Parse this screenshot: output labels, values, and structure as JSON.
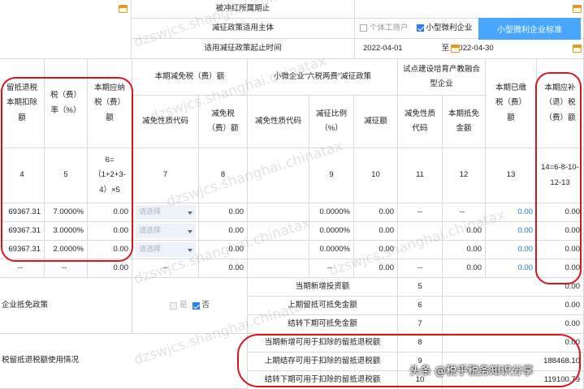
{
  "header": {
    "period_label": "被冲红所属期止",
    "subject_label": "减征政策适用主体",
    "option_individual": "个体工商户",
    "option_small": "小型微利企业",
    "small_standard_btn": "小型微利企业标准",
    "date_range_label": "适用减征政策起止时间",
    "date_start": "2022-04-01",
    "date_to": "至",
    "date_end": "2022-04-30"
  },
  "columns": {
    "col4": "留抵退税本期扣除额",
    "col5": "税（费）率（%）",
    "col6": "本期应纳税（费）额",
    "group_reduce": "本期减免税（费）额",
    "col7": "减免性质代码",
    "col8": "减免税（费）额",
    "group_six": "小微企业“六税两费”减征政策",
    "col9_code": "减免性质代码",
    "col9": "减征比例（%）",
    "col10": "减征额",
    "group_pilot": "试点建设培育产教融合型企业",
    "col11": "减免性质代码",
    "col12": "本期抵免金额",
    "col13": "本期已缴税（费）额",
    "col14": "本期应补（退）税（费）额"
  },
  "col_index": {
    "c4": "4",
    "c5": "5",
    "c6": "6=（1+2+3-4）×5",
    "c7": "7",
    "c8": "8",
    "c9": "9",
    "c10": "10",
    "c11": "11",
    "c12": "12",
    "c13": "13",
    "c14": "14=6-8-10-12-13"
  },
  "rows": [
    {
      "c4": "69367.31",
      "c5": "7.0000%",
      "c6": "0.00",
      "c7": "请选择",
      "c8": "0.00",
      "c9": "0.0000%",
      "c10": "0.00",
      "c11": "--",
      "c12": "--",
      "c13": "0.00",
      "c14": "0.00"
    },
    {
      "c4": "69367.31",
      "c5": "3.0000%",
      "c6": "0.00",
      "c7": "请选择",
      "c8": "0.00",
      "c9": "0.0000%",
      "c10": "0.00",
      "c11": "",
      "c12": "0.00",
      "c13": "0.00",
      "c14": "0.00"
    },
    {
      "c4": "69367.31",
      "c5": "2.0000%",
      "c6": "0.00",
      "c7": "请选择",
      "c8": "0.00",
      "c9": "0.0000%",
      "c10": "0.00",
      "c11": "",
      "c12": "0.00",
      "c13": "0.00",
      "c14": "0.00"
    },
    {
      "c4": "--",
      "c5": "--",
      "c6": "0.00",
      "c7": "--",
      "c8": "0.00",
      "c9": "--",
      "c10": "0.00",
      "c11": "--",
      "c12": "0.00",
      "c13": "0.00",
      "c14": "0.00"
    }
  ],
  "offset": {
    "section_label": "企业抵免政策",
    "yes": "是",
    "no": "否",
    "lines": [
      {
        "label": "当期新增投资额",
        "num": "5",
        "value": "0.00"
      },
      {
        "label": "上期留抵可抵免金额",
        "num": "6",
        "value": "0.00"
      },
      {
        "label": "结转下期可抵免金额",
        "num": "7",
        "value": "0.00"
      }
    ]
  },
  "credit": {
    "section_label": "税留抵退税额使用情况",
    "lines": [
      {
        "label": "当期新增可用于扣除的留抵退税额",
        "num": "8",
        "value": "0.00"
      },
      {
        "label": "上期结存可用于扣除的留抵退税额",
        "num": "9",
        "value": "188468.10"
      },
      {
        "label": "结转下期可用于扣除的留抵退税额",
        "num": "10",
        "value": "119100.79"
      }
    ]
  },
  "watermark": "dzswjcs.shanghai.chinatax",
  "brand": "头条 @税乎税务知识分享",
  "colors": {
    "accent": "#48a6ff",
    "highlight_oval": "#d9141b",
    "link_value": "#1a73c8"
  }
}
